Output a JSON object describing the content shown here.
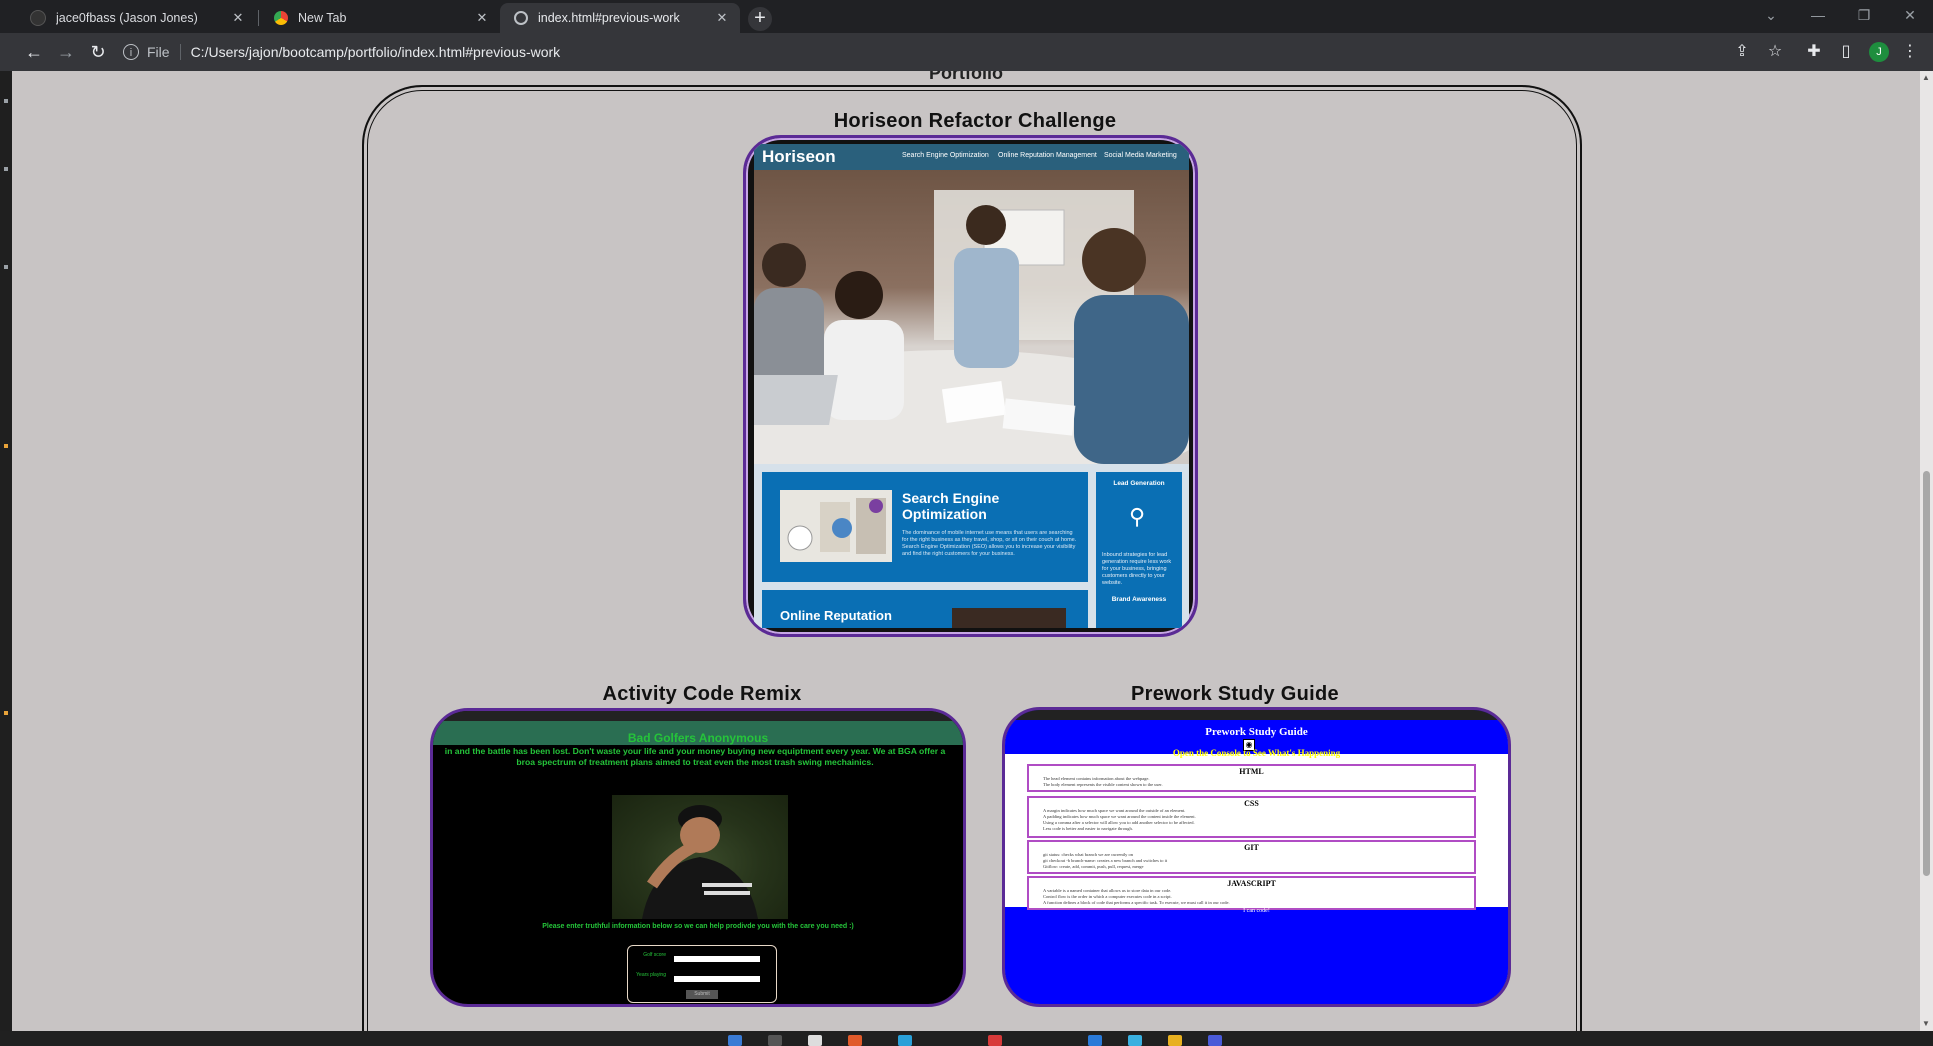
{
  "browser": {
    "tabs": [
      {
        "title": "jace0fbass (Jason Jones)",
        "active": false
      },
      {
        "title": "New Tab",
        "active": false
      },
      {
        "title": "index.html#previous-work",
        "active": true
      }
    ],
    "new_tab_label": "+",
    "address": {
      "scheme_label": "File",
      "url": "C:/Users/jajon/bootcamp/portfolio/index.html#previous-work"
    },
    "profile_initial": "J"
  },
  "page": {
    "section_title": "Portfolio",
    "projects": [
      {
        "title": "Horiseon Refactor Challenge"
      },
      {
        "title": "Activity Code Remix"
      },
      {
        "title": "Prework Study Guide"
      }
    ]
  },
  "horiseon_preview": {
    "logo": "Horiseon",
    "nav": [
      "Search Engine Optimization",
      "Online Reputation Management",
      "Social Media Marketing"
    ],
    "seo_heading": "Search Engine Optimization",
    "seo_text": "The dominance of mobile internet use means that users are searching for the right business as they travel, shop, or sit on their couch at home. Search Engine Optimization (SEO) allows you to increase your visibility and find the right customers for your business.",
    "rep_heading": "Online Reputation",
    "side_lead": "Lead Generation",
    "side_lead_text": "Inbound strategies for lead generation require less work for your business, bringing customers directly to your website.",
    "side_brand": "Brand Awareness"
  },
  "bga_preview": {
    "title": "Bad Golfers Anonymous",
    "text": "in and the battle has been lost. Don't waste your life and your money buying new equiptment every year. We at BGA offer a broa spectrum of treatment plans aimed to treat even the most trash swing mechainics.",
    "prompt": "Please enter truthful information below so we can help prodivde you with the care you need :)",
    "label_1": "Golf score",
    "label_2": "Years playing",
    "submit": "Submit"
  },
  "prework_preview": {
    "title": "Prework Study Guide",
    "subtitle": "Open the Console to See What's Happening",
    "sections": [
      {
        "heading": "HTML",
        "items": [
          "The head element contains information about the webpage.",
          "The body element represents the visible content shown to the user."
        ]
      },
      {
        "heading": "CSS",
        "items": [
          "A margin indicates how much space we want around the outside of an element.",
          "A padding indicates how much space we want around the content inside the element.",
          "Using a comma after a selector will allow you to add another selector to be affected.",
          "Less code is better and easier to navigate through."
        ]
      },
      {
        "heading": "GIT",
        "items": [
          "git status: checks what branch we are currently on",
          "git checkout -b branch-name: creates a new branch and switches to it",
          "Gitflow: create, add, commit, push, pull, request, merge"
        ]
      },
      {
        "heading": "JAVASCRIPT",
        "items": [
          "A variable is a named container that allows us to store data in our code.",
          "Control flow is the order in which a computer executes code in a script.",
          "A function defines a block of code that performs a specific task. To execute, we must call it in our code."
        ]
      }
    ],
    "footer": "I can code!"
  },
  "colors": {
    "card_border": "#5b2a96",
    "page_bg": "#c8c4c4",
    "bga_green": "#25c43a",
    "prework_blue": "#0000ff"
  }
}
